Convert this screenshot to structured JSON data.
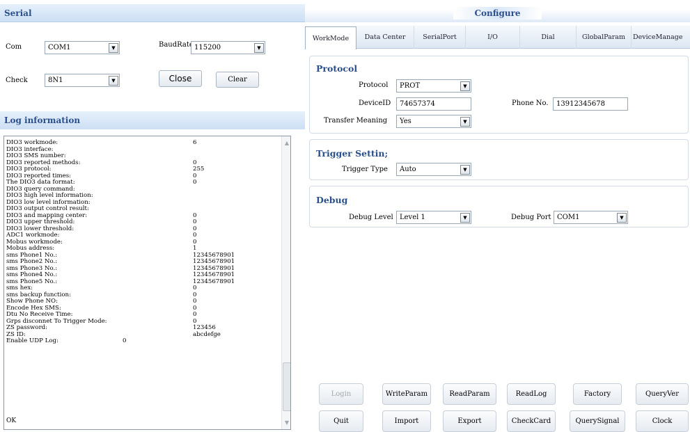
{
  "serial": {
    "title": "Serial",
    "com_label": "Com",
    "com_value": "COM1",
    "baud_label": "BaudRate",
    "baud_value": "115200",
    "check_label": "Check",
    "check_value": "8N1",
    "close_label": "Close",
    "clear_label": "Clear"
  },
  "log": {
    "title": "Log information",
    "lines": [
      {
        "k": "DIO3 workmode:",
        "v": "6"
      },
      {
        "k": "DIO3 interface:",
        "v": ""
      },
      {
        "k": "DIO3 SMS number:",
        "v": ""
      },
      {
        "k": "DIO3 reported methods:",
        "v": "0"
      },
      {
        "k": "DIO3 protocol:",
        "v": "255"
      },
      {
        "k": "DIO3 reported times:",
        "v": "0"
      },
      {
        "k": "The DIO3 data format:",
        "v": "0"
      },
      {
        "k": "DIO3 query command:",
        "v": ""
      },
      {
        "k": "DIO3 high level information:",
        "v": ""
      },
      {
        "k": "DIO3 low level information:",
        "v": ""
      },
      {
        "k": "DIO3 output control result:",
        "v": ""
      },
      {
        "k": "DIO3 and mapping center:",
        "v": "0"
      },
      {
        "k": "DIO3 upper threshold:",
        "v": "0"
      },
      {
        "k": "DIO3 lower threshold:",
        "v": "0"
      },
      {
        "k": "ADC1 workmode:",
        "v": "0"
      },
      {
        "k": "Mobus workmode:",
        "v": "0"
      },
      {
        "k": "Mobus address:",
        "v": "1"
      },
      {
        "k": "sms Phone1 No.:",
        "v": "12345678901"
      },
      {
        "k": "sms Phone2 No.:",
        "v": "12345678901"
      },
      {
        "k": "sms Phone3 No.:",
        "v": "12345678901"
      },
      {
        "k": "sms Phone4 No.:",
        "v": "12345678901"
      },
      {
        "k": "sms Phone5 No.:",
        "v": "12345678901"
      },
      {
        "k": "sms hex:",
        "v": "0"
      },
      {
        "k": "sms backup function:",
        "v": "0"
      },
      {
        "k": "Show Phone NO:",
        "v": "0"
      },
      {
        "k": "Encode Hex SMS:",
        "v": "0"
      },
      {
        "k": "Dtu No Receive Time:",
        "v": "0"
      },
      {
        "k": "Grps disconnet To Trigger Mode:",
        "v": "0"
      },
      {
        "k": "ZS password:",
        "v": "123456"
      },
      {
        "k": "ZS ID:",
        "v": "abcdefge"
      },
      {
        "k": "Enable UDP Log:",
        "v": ""
      }
    ],
    "udp_value": "0",
    "ok": "OK"
  },
  "configure": {
    "title": "Configure",
    "tabs": [
      "WorkMode",
      "Data Center",
      "SerialPort",
      "I/O",
      "Dial",
      "GlobalParam",
      "DeviceManage"
    ],
    "protocol_group": "Protocol",
    "protocol_label": "Protocol",
    "protocol_value": "PROT",
    "device_id_label": "DeviceID",
    "device_id_value": "74657374",
    "phone_label": "Phone No.",
    "phone_value": "13912345678",
    "transfer_label": "Transfer Meaning",
    "transfer_value": "Yes",
    "trigger_group": "Trigger Settin;",
    "trigger_type_label": "Trigger Type",
    "trigger_type_value": "Auto",
    "debug_group": "Debug",
    "debug_level_label": "Debug Level",
    "debug_level_value": "Level 1",
    "debug_port_label": "Debug Port",
    "debug_port_value": "COM1"
  },
  "buttons": {
    "login": "Login",
    "write_param": "WriteParam",
    "read_param": "ReadParam",
    "read_log": "ReadLog",
    "factory": "Factory",
    "query_ver": "QueryVer",
    "quit": "Quit",
    "import": "Import",
    "export": "Export",
    "check_card": "CheckCard",
    "query_signal": "QuerySignal",
    "clock": "Clock"
  }
}
